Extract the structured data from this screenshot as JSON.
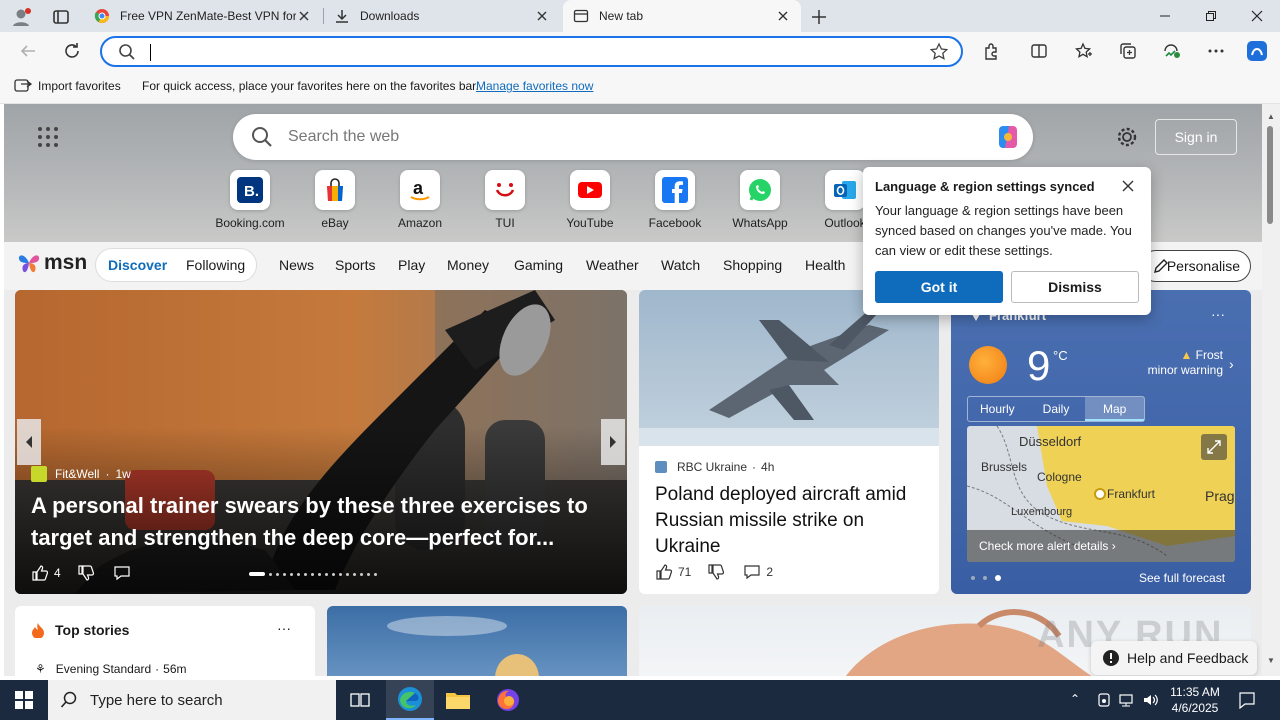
{
  "tabs": [
    {
      "title": "Free VPN ZenMate-Best VPN for"
    },
    {
      "title": "Downloads"
    },
    {
      "title": "New tab"
    }
  ],
  "address": {
    "value": "",
    "placeholder": ""
  },
  "favbar": {
    "import_label": "Import favorites",
    "hint": "For quick access, place your favorites here on the favorites bar.",
    "manage_link": "Manage favorites now"
  },
  "newtab": {
    "search_placeholder": "Search the web",
    "signin": "Sign in",
    "quick_links": [
      {
        "label": "Booking.com"
      },
      {
        "label": "eBay"
      },
      {
        "label": "Amazon"
      },
      {
        "label": "TUI"
      },
      {
        "label": "YouTube"
      },
      {
        "label": "Facebook"
      },
      {
        "label": "WhatsApp"
      },
      {
        "label": "Outlook"
      }
    ]
  },
  "msn": {
    "logo": "msn",
    "tabs": [
      "Discover",
      "Following"
    ],
    "nav": [
      "News",
      "Sports",
      "Play",
      "Money",
      "Gaming",
      "Weather",
      "Watch",
      "Shopping",
      "Health"
    ],
    "personalise": "Personalise"
  },
  "hero_card": {
    "source": "Fit&Well",
    "age": "1w",
    "headline": "A personal trainer swears by these three exercises to target and strengthen the deep core—perfect for...",
    "likes": "4"
  },
  "news_card": {
    "source": "RBC Ukraine",
    "age": "4h",
    "headline": "Poland deployed aircraft amid Russian missile strike on Ukraine",
    "likes": "71",
    "comments": "2"
  },
  "weather": {
    "location": "Frankfurt",
    "temp": "9",
    "unit": "°C",
    "warning_title": "Frost",
    "warning_sub": "minor warning",
    "tabs": [
      "Hourly",
      "Daily",
      "Map"
    ],
    "active_tab": "Map",
    "map_labels": [
      "Düsseldorf",
      "Brussels",
      "Cologne",
      "Frankfurt",
      "Luxembourg",
      "Prag"
    ],
    "alert_link": "Check more alert details",
    "forecast_link": "See full forecast"
  },
  "top_stories": {
    "title": "Top stories",
    "item_source": "Evening Standard",
    "item_age": "56m"
  },
  "popup": {
    "title": "Language & region settings synced",
    "body": "Your language & region settings have been synced based on changes you've made. You can view or edit these settings.",
    "primary": "Got it",
    "secondary": "Dismiss"
  },
  "help": "Help and Feedback",
  "watermark": "ANY RUN",
  "taskbar": {
    "search_placeholder": "Type here to search",
    "time": "11:35 AM",
    "date": "4/6/2025"
  },
  "colors": {
    "accent": "#0f6cbd",
    "taskbar": "#1b2a3f"
  }
}
